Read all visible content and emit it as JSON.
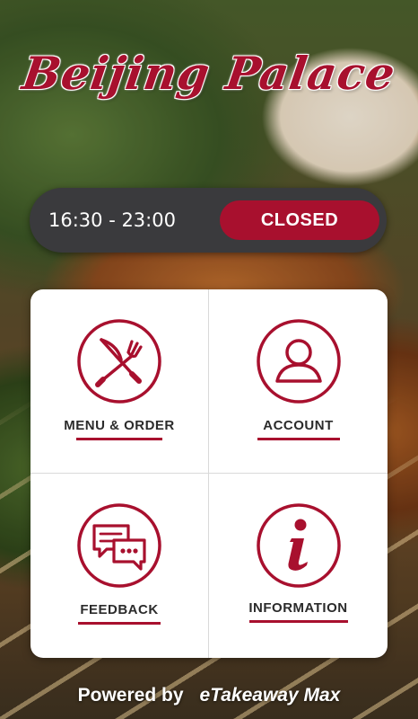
{
  "app": {
    "title": "Beijing Palace"
  },
  "hours": {
    "time_range": "16:30 - 23:00",
    "status": "CLOSED"
  },
  "menu": {
    "items": [
      {
        "label": "MENU & ORDER",
        "icon": "knife-fork-icon"
      },
      {
        "label": "ACCOUNT",
        "icon": "user-icon"
      },
      {
        "label": "FEEDBACK",
        "icon": "chat-bubbles-icon"
      },
      {
        "label": "INFORMATION",
        "icon": "info-icon"
      }
    ]
  },
  "footer": {
    "powered_by": "Powered by",
    "brand": "eTakeaway Max"
  },
  "colors": {
    "accent": "#a8102e",
    "bar": "#3a3a3d"
  }
}
